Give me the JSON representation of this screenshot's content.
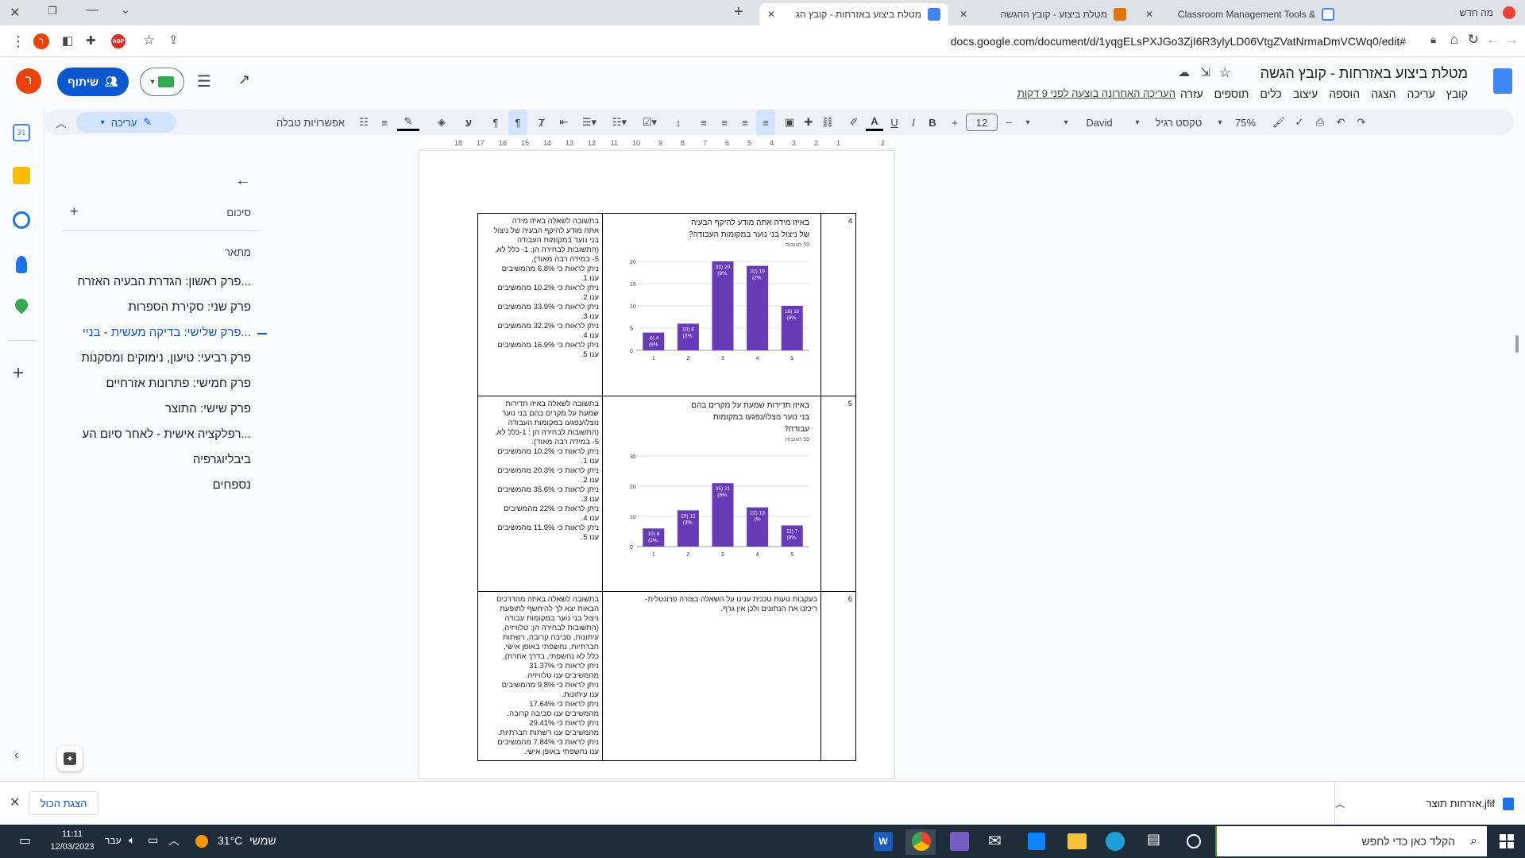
{
  "tabs": [
    {
      "title": "מטלת ביצוע באזרחות - קובץ הג",
      "active": true
    },
    {
      "title": "מטלת ביצוע - קובץ ההגשה",
      "active": false
    },
    {
      "title": "Classroom Management Tools &",
      "active": false
    }
  ],
  "new_tab_label": "מה חדש",
  "address": {
    "url": "docs.google.com/document/d/1yqgELsPXJGo3ZjI6R3ylyLD06VtgZVatNrmaDmVCWq0/edit#"
  },
  "doc": {
    "title": "מטלת ביצוע באזרחות - קובץ הגשה",
    "menu": [
      "קובץ",
      "עריכה",
      "הצגה",
      "הוספה",
      "עיצוב",
      "כלים",
      "תוספים",
      "עזרה"
    ],
    "last_edit": "העריכה האחרונה בוצעה לפני 9 דקות",
    "share_label": "שיתוף",
    "avatar_letter": "ר"
  },
  "toolbar": {
    "zoom": "75%",
    "style": "טקסט רגיל",
    "font": "David",
    "font_size": "12",
    "table_options": "אפשרויות טבלה",
    "mode": "עריכה"
  },
  "ruler": {
    "ticks": [
      "2",
      "",
      "1",
      "2",
      "3",
      "4",
      "5",
      "6",
      "7",
      "8",
      "9",
      "10",
      "11",
      "12",
      "13",
      "14",
      "15",
      "16",
      "17",
      "18"
    ]
  },
  "outline": {
    "summary_label": "סיכום",
    "outline_label": "מתאר",
    "items": [
      {
        "text": "פרק ראשון: הגדרת הבעיה האזרח...",
        "active": false
      },
      {
        "text": "פרק שני: סקירת הספרות",
        "active": false
      },
      {
        "text": "פרק שלישי: בדיקה מעשית - בניי...",
        "active": true
      },
      {
        "text": "פרק רביעי: טיעון, נימוקים ומסקנות",
        "active": false
      },
      {
        "text": "פרק חמישי: פתרונות אזרחיים",
        "active": false
      },
      {
        "text": "פרק שישי: התוצר",
        "active": false
      },
      {
        "text": "רפלקציה אישית - לאחר סיום הע...",
        "active": false
      },
      {
        "text": "ביבליוגרפיה",
        "active": false
      },
      {
        "text": "נספחים",
        "active": false
      }
    ]
  },
  "rows": [
    {
      "num": "4",
      "question": [
        "באיזו מידה אתה מודע להיקף הבעיה",
        "של ניצול בני נוער במקומות העבודה?"
      ],
      "responses": "59 תגובות",
      "answer": [
        "בתשובה לשאלה באיזו מידה",
        "אתה מודע להיקף הבעיה של ניצול",
        "בני נוער במקומות העבודה",
        "(התשובות לבחירה הן: 1- כלל לא,",
        "5- במידה רבה מאוד),",
        "ניתן לראות כי 6.8% מהמשיבים",
        "ענו 1.",
        "ניתן לראות כי 10.2% מהמשיבים",
        "ענו 2.",
        "ניתן לראות כי 33.9% מהמשיבים",
        "ענו 3.",
        "ניתן לראות כי 32.2% מהמשיבים",
        "ענו 4.",
        "ניתן לראות כי 16.9% מהמשיבים",
        "ענו 5."
      ]
    },
    {
      "num": "5",
      "question": [
        "באיזו תדירות שמעת על מקרים בהם",
        "בני נוער נוצלו/נפגעו במקומות",
        "עבודה?"
      ],
      "responses": "59 תגובות",
      "answer": [
        "בתשובה לשאלה באיזו תדירות",
        "שמעת על מקרים בהם בני נוער",
        "נוצלו/נפגעו במקומות העבודה",
        "(התשובות לבחירה הן : 1-כלל לא,",
        "5- במידה רבה מאוד).",
        "ניתן לראות כי 10.2% מהמשיבים",
        "ענו 1.",
        "ניתן לראות כי 20.3% מהמשיבים",
        "ענו 2.",
        "ניתן לראות כי 35.6% מהמשיבים",
        "ענו 3.",
        "ניתן לראות כי 22% מהמשיבים",
        "ענו 4.",
        "ניתן לראות כי 11.9% מהמשיבים",
        "ענו 5."
      ]
    },
    {
      "num": "6",
      "question": [
        "בעקבות טעות טכנית ענינו על השאלה בצורה פרונטלית-",
        "ריכזנו את הנתונים ולכן אין גרף."
      ],
      "responses": "",
      "answer": [
        "בתשובה לשאלה באיזה מהדרכים",
        "הבאות יצא לך להיחשף לתופעת",
        "ניצול בני נוער במקומות עבודה",
        "(התשובות לבחירה הן: טלוויזיה,",
        "עיתונות, סביבה קרובה, רשתות",
        "חברתיות, נחשפתי באופן אישי,",
        "כלל לא נחשפתי, בדרך אחרת).",
        "ניתן לראות כי 31.37%",
        "מהמשיבים ענו טלוויזיה.",
        "ניתן לראות כי 9.8% מהמשיבים",
        "ענו עיתונות.",
        "ניתן לראות כי 17.64%",
        "מהמשיבים ענו סביבה קרובה.",
        "ניתן לראות כי 29.41%",
        "מהמשיבים ענו רשתות חברתיות.",
        "ניתן לראות כי 7.84% מהמשיבים",
        "ענו נחשפתי באופן אישי."
      ]
    }
  ],
  "chart_data": [
    {
      "type": "bar",
      "title": "באיזו מידה אתה מודע להיקף הבעיה של ניצול בני נוער במקומות העבודה?",
      "categories": [
        "1",
        "2",
        "3",
        "4",
        "5"
      ],
      "values": [
        4,
        6,
        20,
        19,
        10
      ],
      "data_labels": [
        "4 (6.8%)",
        "6 (10.2%)",
        "20 (33.9%)",
        "19 (32.2%)",
        "10 (16.9%)"
      ],
      "ylim": [
        0,
        20
      ],
      "yticks": [
        0,
        5,
        10,
        15,
        20
      ],
      "color": "#673ab7",
      "grid": true
    },
    {
      "type": "bar",
      "title": "באיזו תדירות שמעת על מקרים בהם בני נוער נוצלו/נפגעו במקומות עבודה?",
      "categories": [
        "1",
        "2",
        "3",
        "4",
        "5"
      ],
      "values": [
        6,
        12,
        21,
        13,
        7
      ],
      "data_labels": [
        "6 (10.2%)",
        "12 (20.3%)",
        "21 (35.6%)",
        "13 (22%)",
        "7 (11.9%)"
      ],
      "ylim": [
        0,
        30
      ],
      "yticks": [
        0,
        10,
        20,
        30
      ],
      "color": "#673ab7",
      "grid": true
    }
  ],
  "download": {
    "file": "אזרחות תוצר.jfif",
    "show_all": "הצגת הכול"
  },
  "taskbar": {
    "search_placeholder": "הקלד כאן כדי לחפש",
    "weather": "31°C",
    "weather_text": "שמשי",
    "lang": "עבר",
    "time": "11:11",
    "date": "12/03/2023"
  }
}
